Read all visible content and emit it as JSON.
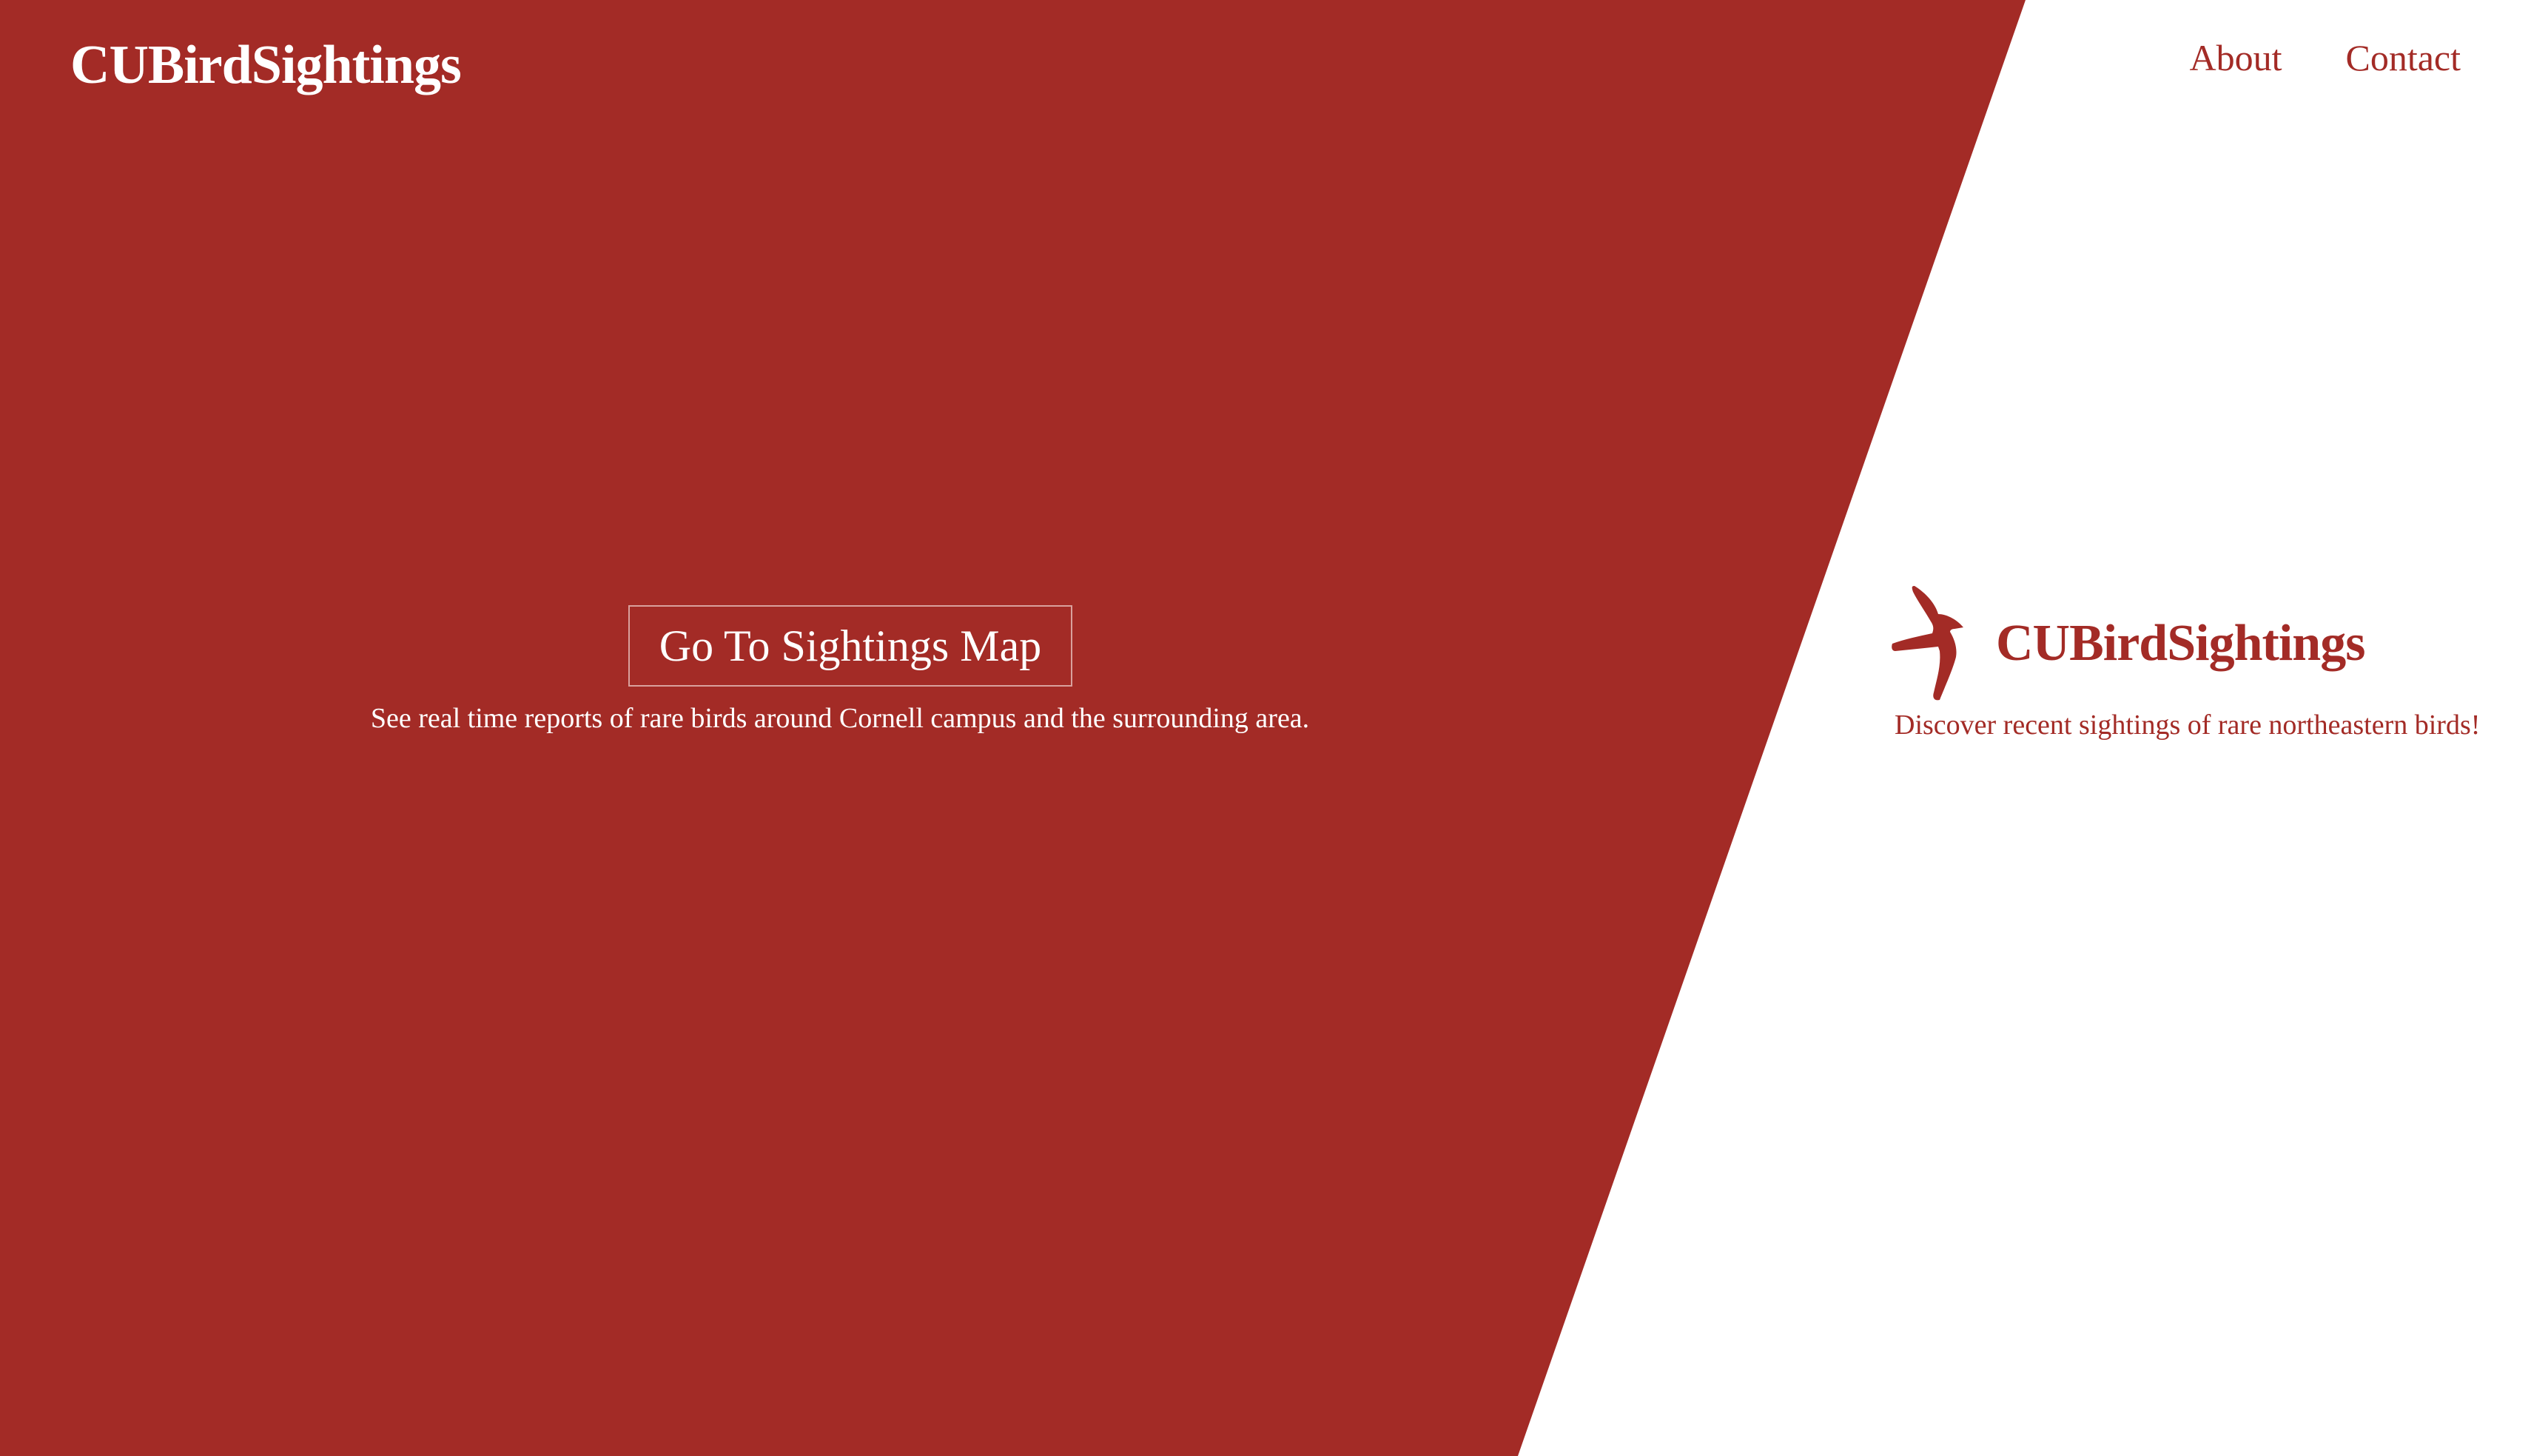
{
  "header": {
    "brand": "CUBirdSightings",
    "nav": [
      {
        "label": "About"
      },
      {
        "label": "Contact"
      }
    ]
  },
  "hero": {
    "button_label": "Go To Sightings Map",
    "subtitle": "See real time reports of rare birds around Cornell campus and the surrounding area."
  },
  "side": {
    "logo_icon": "bird-icon",
    "title": "CUBirdSightings",
    "tagline": "Discover recent sightings of rare northeastern birds!"
  },
  "colors": {
    "primary": "#a32b26",
    "background": "#ffffff",
    "text_on_primary": "#ffffff"
  }
}
